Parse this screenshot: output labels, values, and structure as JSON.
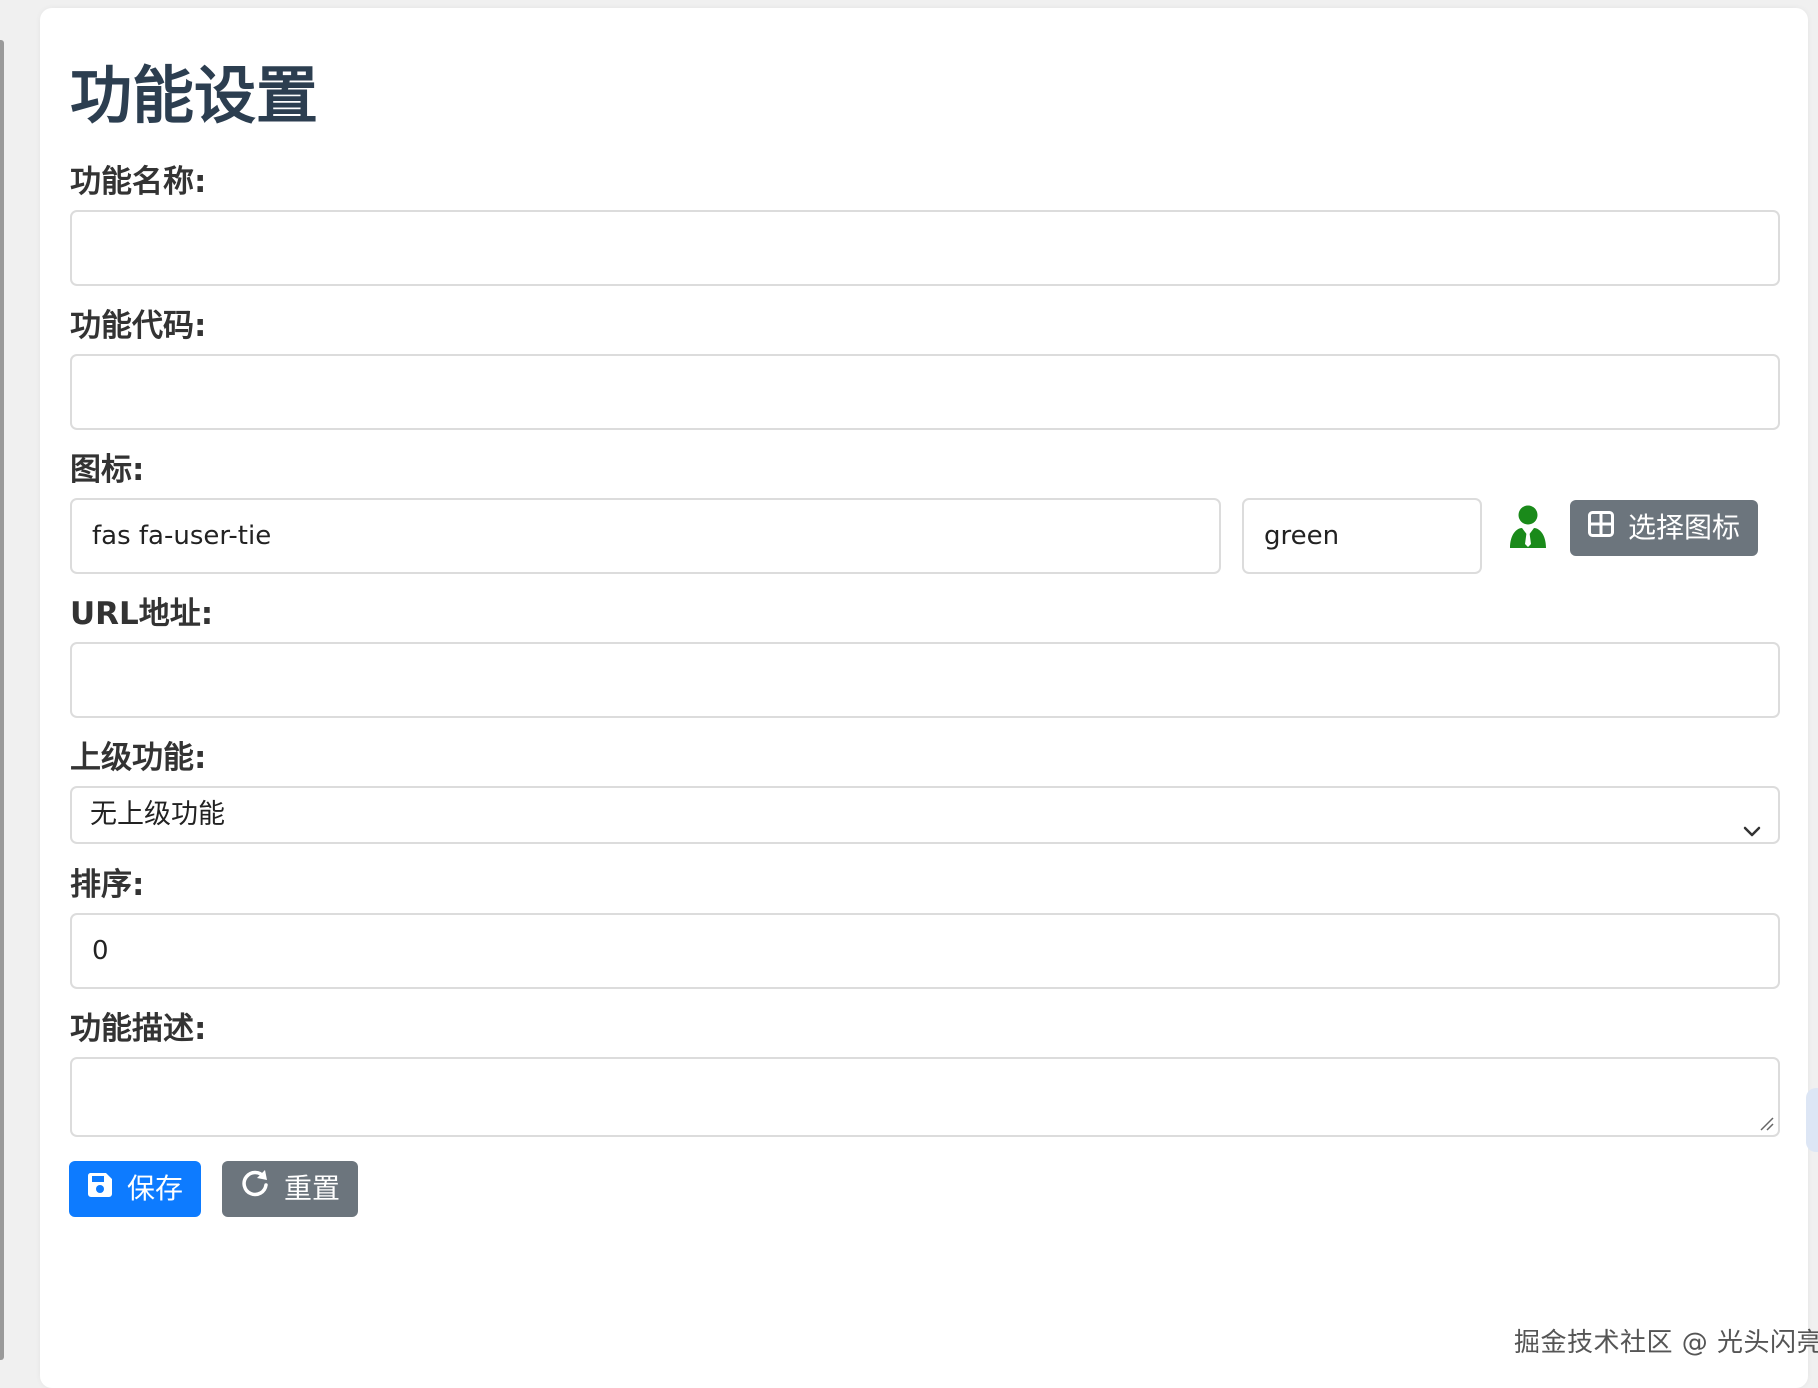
{
  "form": {
    "title": "功能设置",
    "name_label": "功能名称:",
    "name_value": "",
    "code_label": "功能代码:",
    "code_value": "",
    "icon_label": "图标:",
    "icon_value": "fas fa-user-tie",
    "icon_color_value": "green",
    "icon_preview_color": "#1a8a1a",
    "choose_icon_label": "选择图标",
    "url_label": "URL地址:",
    "url_value": "",
    "parent_label": "上级功能:",
    "parent_selected": "无上级功能",
    "sort_label": "排序:",
    "sort_value": "0",
    "desc_label": "功能描述:",
    "desc_value": ""
  },
  "actions": {
    "save_label": "保存",
    "reset_label": "重置"
  },
  "watermark": "掘金技术社区 @ 光头闪亮亮",
  "colors": {
    "primary": "#0d7bff",
    "secondary": "#6c757d",
    "title": "#2c3e50"
  },
  "icons": {
    "save": "floppy-disk-icon",
    "reset": "rotate-icon",
    "choose": "grid-icon",
    "preview": "user-tie-icon"
  }
}
